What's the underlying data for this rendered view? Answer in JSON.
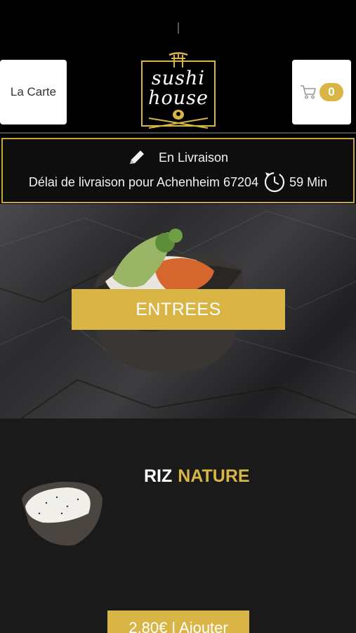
{
  "header": {
    "menu_label": "La Carte",
    "cart_count": "0",
    "logo_line1": "sushi",
    "logo_line2": "house"
  },
  "delivery": {
    "mode": "En Livraison",
    "delay_text": "Délai de livraison pour Achenheim 67204",
    "duration": "59 Min"
  },
  "category": {
    "label": "ENTREES"
  },
  "product": {
    "name_part1": "RIZ",
    "name_part2": "NATURE",
    "price_button": "2,80€ | Ajouter"
  },
  "colors": {
    "accent": "#d8b545",
    "background": "#000000",
    "section_bg": "#1a1a1a"
  }
}
